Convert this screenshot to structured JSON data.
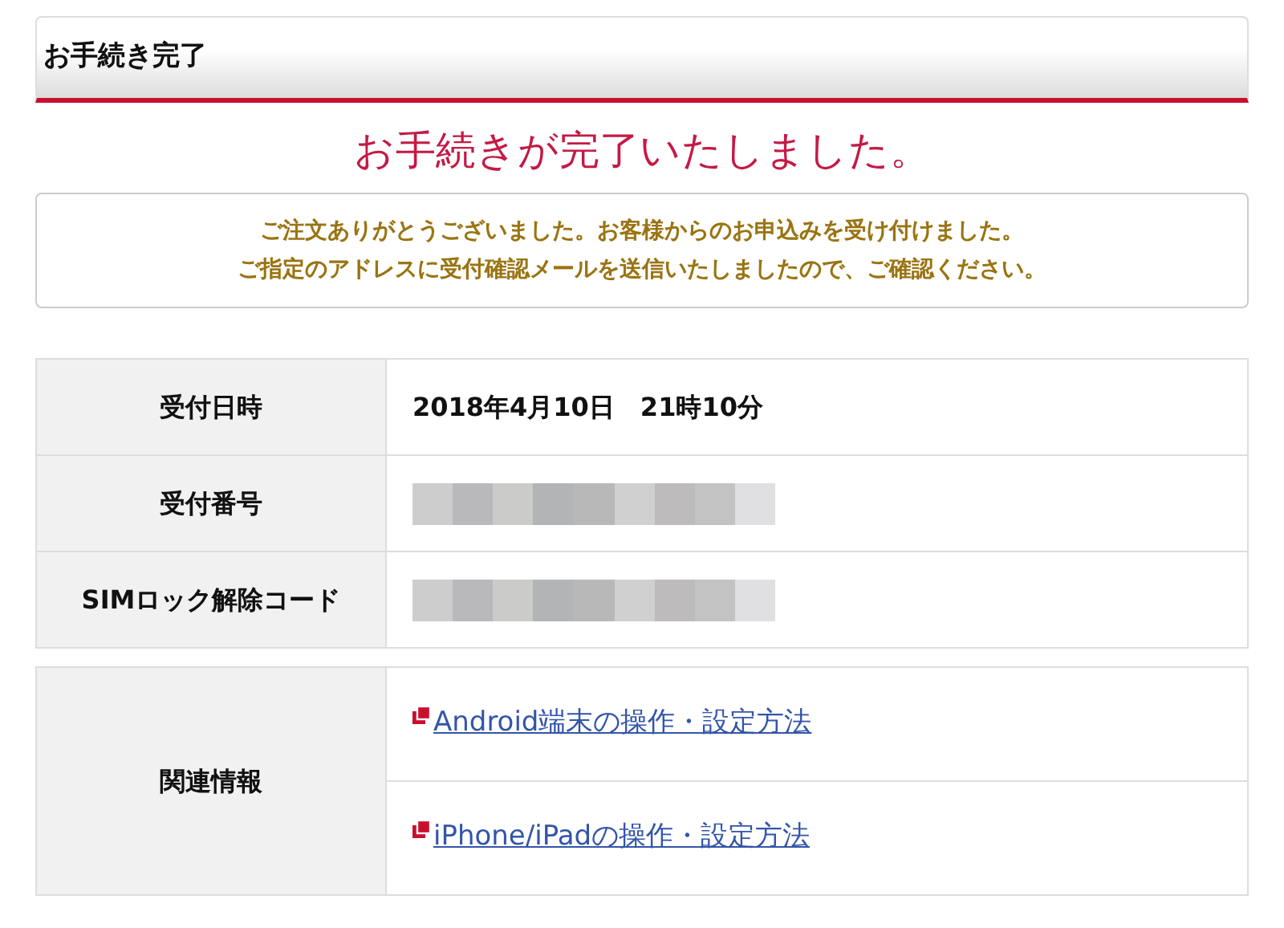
{
  "header": {
    "title": "お手続き完了"
  },
  "heading": "お手続きが完了いたしました。",
  "notice": [
    "ご注文ありがとうございました。お客様からのお申込みを受け付けました。",
    "ご指定のアドレスに受付確認メールを送信いたしましたので、ご確認ください。"
  ],
  "details": [
    {
      "label": "受付日時",
      "kind": "text",
      "value": "2018年4月10日　21時10分"
    },
    {
      "label": "受付番号",
      "kind": "redacted"
    },
    {
      "label": "SIMロック解除コード",
      "kind": "redacted"
    }
  ],
  "related": {
    "label": "関連情報",
    "links": [
      "Android端末の操作・設定方法",
      "iPhone/iPadの操作・設定方法"
    ]
  }
}
